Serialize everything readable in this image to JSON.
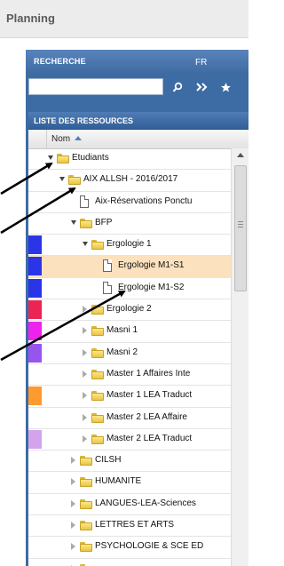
{
  "app": {
    "title": "Planning"
  },
  "search": {
    "title": "RECHERCHE",
    "lang": "FR",
    "value": "",
    "placeholder": ""
  },
  "resources": {
    "title": "LISTE DES RESSOURCES",
    "column": "Nom",
    "rows": [
      {
        "label": "Etudiants",
        "type": "folder",
        "toggle": "open",
        "level": 0,
        "color": null,
        "selected": false
      },
      {
        "label": "AIX ALLSH - 2016/2017",
        "type": "folder",
        "toggle": "open",
        "level": 1,
        "color": null,
        "selected": false
      },
      {
        "label": "Aix-Réservations Ponctu",
        "type": "doc",
        "toggle": null,
        "level": 2,
        "color": null,
        "selected": false
      },
      {
        "label": "BFP",
        "type": "folder",
        "toggle": "open",
        "level": 2,
        "color": null,
        "selected": false
      },
      {
        "label": "Ergologie 1",
        "type": "folder",
        "toggle": "open",
        "level": 3,
        "color": "#2b35e8",
        "selected": false
      },
      {
        "label": "Ergologie M1-S1",
        "type": "doc",
        "toggle": null,
        "level": 4,
        "color": "#2b35e8",
        "selected": true
      },
      {
        "label": "Ergologie M1-S2",
        "type": "doc",
        "toggle": null,
        "level": 4,
        "color": "#2b35e8",
        "selected": false
      },
      {
        "label": "Ergologie 2",
        "type": "folder",
        "toggle": "closed",
        "level": 3,
        "color": "#ec2456",
        "selected": false
      },
      {
        "label": "Masni 1",
        "type": "folder",
        "toggle": "closed",
        "level": 3,
        "color": "#ee22ee",
        "selected": false
      },
      {
        "label": "Masni 2",
        "type": "folder",
        "toggle": "closed",
        "level": 3,
        "color": "#9656ee",
        "selected": false
      },
      {
        "label": "Master 1 Affaires Inte",
        "type": "folder",
        "toggle": "closed",
        "level": 3,
        "color": null,
        "selected": false
      },
      {
        "label": "Master 1 LEA Traduct",
        "type": "folder",
        "toggle": "closed",
        "level": 3,
        "color": "#ff9a2e",
        "selected": false
      },
      {
        "label": "Master 2 LEA Affaire",
        "type": "folder",
        "toggle": "closed",
        "level": 3,
        "color": null,
        "selected": false
      },
      {
        "label": "Master 2 LEA Traduct",
        "type": "folder",
        "toggle": "closed",
        "level": 3,
        "color": "#d3a3ee",
        "selected": false
      },
      {
        "label": "CILSH",
        "type": "folder",
        "toggle": "closed",
        "level": 2,
        "color": null,
        "selected": false
      },
      {
        "label": "HUMANITE",
        "type": "folder",
        "toggle": "closed",
        "level": 2,
        "color": null,
        "selected": false
      },
      {
        "label": "LANGUES-LEA-Sciences",
        "type": "folder",
        "toggle": "closed",
        "level": 2,
        "color": null,
        "selected": false
      },
      {
        "label": "LETTRES ET ARTS",
        "type": "folder",
        "toggle": "closed",
        "level": 2,
        "color": null,
        "selected": false
      },
      {
        "label": "PSYCHOLOGIE & SCE ED",
        "type": "folder",
        "toggle": "closed",
        "level": 2,
        "color": null,
        "selected": false
      },
      {
        "label": "",
        "type": "folder",
        "toggle": "closed",
        "level": 2,
        "color": null,
        "selected": false
      }
    ]
  },
  "colors": {
    "panel": "#3d6ba3",
    "selected_row": "#fbe1be",
    "arrow": "#000000"
  }
}
